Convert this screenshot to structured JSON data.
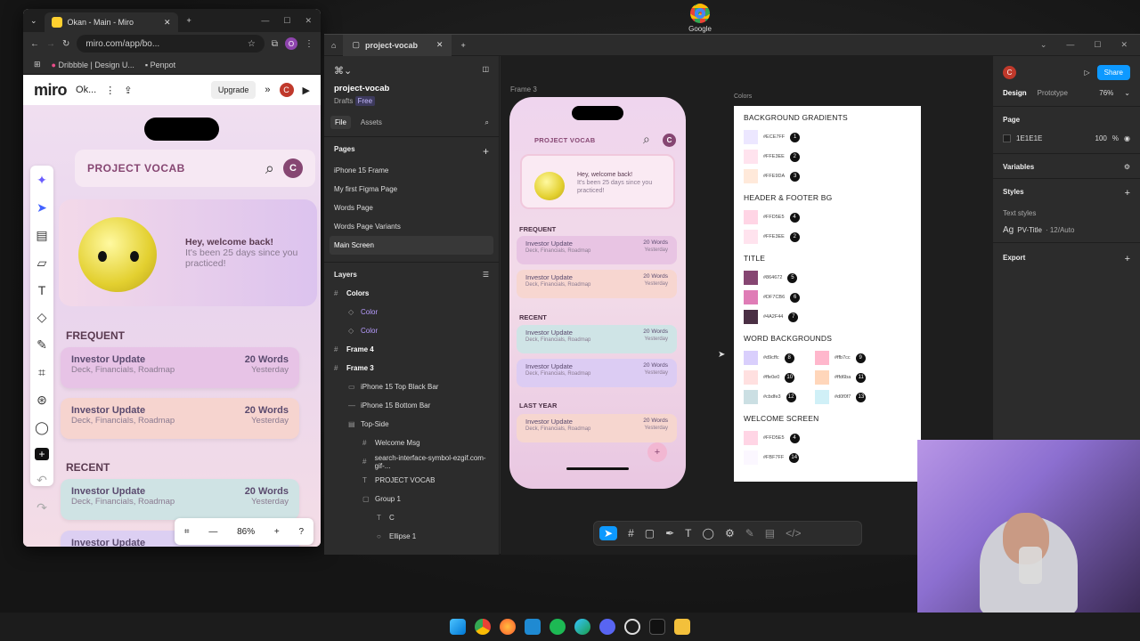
{
  "desktop": {
    "google_label": "Google"
  },
  "chrome": {
    "tab_title": "Okan - Main - Miro",
    "url": "miro.com/app/bo...",
    "bookmarks": [
      "Dribbble | Design U...",
      "Penpot"
    ],
    "miro": {
      "logo": "miro",
      "board_name": "Ok...",
      "upgrade": "Upgrade",
      "avatar": "C",
      "zoom": "86%"
    },
    "preview": {
      "title": "PROJECT VOCAB",
      "avatar": "C",
      "welcome_title": "Hey, welcome back!",
      "welcome_sub": "It's been 25 days since you practiced!",
      "frequent": "FREQUENT",
      "recent": "RECENT",
      "cards": [
        {
          "title": "Investor Update",
          "sub": "Deck, Financials, Roadmap",
          "words": "20 Words",
          "when": "Yesterday",
          "bg": "#e7c3e6"
        },
        {
          "title": "Investor Update",
          "sub": "Deck, Financials, Roadmap",
          "words": "20 Words",
          "when": "Yesterday",
          "bg": "#f6d4cf"
        },
        {
          "title": "Investor Update",
          "sub": "Deck, Financials, Roadmap",
          "words": "20 Words",
          "when": "Yesterday",
          "bg": "#cfe3e4"
        },
        {
          "title": "Investor Update",
          "sub": "",
          "words": "",
          "when": "",
          "bg": "#dccff2"
        }
      ]
    }
  },
  "figma": {
    "tab": "project-vocab",
    "file_name": "project-vocab",
    "drafts": "Drafts",
    "free": "Free",
    "tabs": {
      "file": "File",
      "assets": "Assets"
    },
    "pages_label": "Pages",
    "pages": [
      "iPhone 15 Frame",
      "My first Figma Page",
      "Words Page",
      "Words Page Variants",
      "Main Screen"
    ],
    "layers_label": "Layers",
    "layers": [
      {
        "name": "Colors",
        "icon": "#",
        "indent": 0,
        "bold": true
      },
      {
        "name": "Color",
        "icon": "◇",
        "indent": 1,
        "bold": false,
        "color": "#b79cff"
      },
      {
        "name": "Color",
        "icon": "◇",
        "indent": 1,
        "bold": false,
        "color": "#b79cff"
      },
      {
        "name": "Frame 4",
        "icon": "#",
        "indent": 0,
        "bold": true
      },
      {
        "name": "Frame 3",
        "icon": "#",
        "indent": 0,
        "bold": true
      },
      {
        "name": "iPhone 15 Top Black Bar",
        "icon": "▭",
        "indent": 1,
        "bold": false
      },
      {
        "name": "iPhone 15 Bottom Bar",
        "icon": "—",
        "indent": 1,
        "bold": false
      },
      {
        "name": "Top-Side",
        "icon": "▤",
        "indent": 1,
        "bold": false
      },
      {
        "name": "Welcome Msg",
        "icon": "#",
        "indent": 2,
        "bold": false
      },
      {
        "name": "search-interface-symbol-ezgif.com-gif-...",
        "icon": "#",
        "indent": 2,
        "bold": false
      },
      {
        "name": "PROJECT VOCAB",
        "icon": "T",
        "indent": 2,
        "bold": false
      },
      {
        "name": "Group 1",
        "icon": "▢",
        "indent": 2,
        "bold": false
      },
      {
        "name": "C",
        "icon": "T",
        "indent": 3,
        "bold": false
      },
      {
        "name": "Ellipse 1",
        "icon": "○",
        "indent": 3,
        "bold": false
      }
    ],
    "frame_label": "Frame 3",
    "colors_label": "Colors",
    "phone": {
      "title": "PROJECT VOCAB",
      "avatar": "C",
      "welcome_title": "Hey, welcome back!",
      "welcome_sub": "It's been 25 days since you practiced!",
      "frequent": "FREQUENT",
      "recent": "RECENT",
      "last_year": "LAST YEAR",
      "plus": "+",
      "cards": [
        {
          "title": "Investor Update",
          "sub": "Deck, Financials, Roadmap",
          "words": "20 Words",
          "when": "Yesterday",
          "bg": "#e8c4e3"
        },
        {
          "title": "Investor Update",
          "sub": "Deck, Financials, Roadmap",
          "words": "20 Words",
          "when": "Yesterday",
          "bg": "#f7d6d0"
        },
        {
          "title": "Investor Update",
          "sub": "Deck, Financials, Roadmap",
          "words": "20 Words",
          "when": "Yesterday",
          "bg": "#cfe4e6"
        },
        {
          "title": "Investor Update",
          "sub": "Deck, Financials, Roadmap",
          "words": "20 Words",
          "when": "Yesterday",
          "bg": "#dcccf3"
        },
        {
          "title": "Investor Update",
          "sub": "Deck, Financials, Roadmap",
          "words": "20 Words",
          "when": "Yesterday",
          "bg": "#f6d6cf"
        }
      ]
    },
    "color_sheet": {
      "bg_gradients": "BACKGROUND GRADIENTS",
      "bg_list": [
        {
          "hex": "#ECE7FF",
          "n": "1"
        },
        {
          "hex": "#FFE3EE",
          "n": "2"
        },
        {
          "hex": "#FFE9DA",
          "n": "3"
        }
      ],
      "header_footer": "HEADER & FOOTER BG",
      "hf_list": [
        {
          "hex": "#FFD5E5",
          "n": "4"
        },
        {
          "hex": "#FFE3EE",
          "n": "2"
        }
      ],
      "title": "TITLE",
      "title_list": [
        {
          "hex": "#864672",
          "n": "5"
        },
        {
          "hex": "#DF7CB6",
          "n": "6"
        },
        {
          "hex": "#4A2F44",
          "n": "7"
        }
      ],
      "word_bgs": "WORD BACKGROUNDS",
      "word_list": [
        {
          "hex": "#d9cffc",
          "n": "8"
        },
        {
          "hex": "#ffb7cc",
          "n": "9"
        },
        {
          "hex": "#ffe0e0",
          "n": "10"
        },
        {
          "hex": "#ffd6ba",
          "n": "11"
        },
        {
          "hex": "#cbdfe3",
          "n": "12"
        },
        {
          "hex": "#d0f0f7",
          "n": "13"
        }
      ],
      "welcome": "WELCOME SCREEN",
      "welcome_list": [
        {
          "hex": "#FFD5E5",
          "n": "4"
        },
        {
          "hex": "#FBF7FF",
          "n": "14"
        }
      ]
    },
    "right": {
      "avatar": "C",
      "share": "Share",
      "design": "Design",
      "prototype": "Prototype",
      "zoom": "76%",
      "page": "Page",
      "page_color": "1E1E1E",
      "page_opacity": "100",
      "pct": "%",
      "variables": "Variables",
      "styles": "Styles",
      "text_styles": "Text styles",
      "style_name": "PV-Title",
      "style_spec": "· 12/Auto",
      "export": "Export"
    }
  }
}
